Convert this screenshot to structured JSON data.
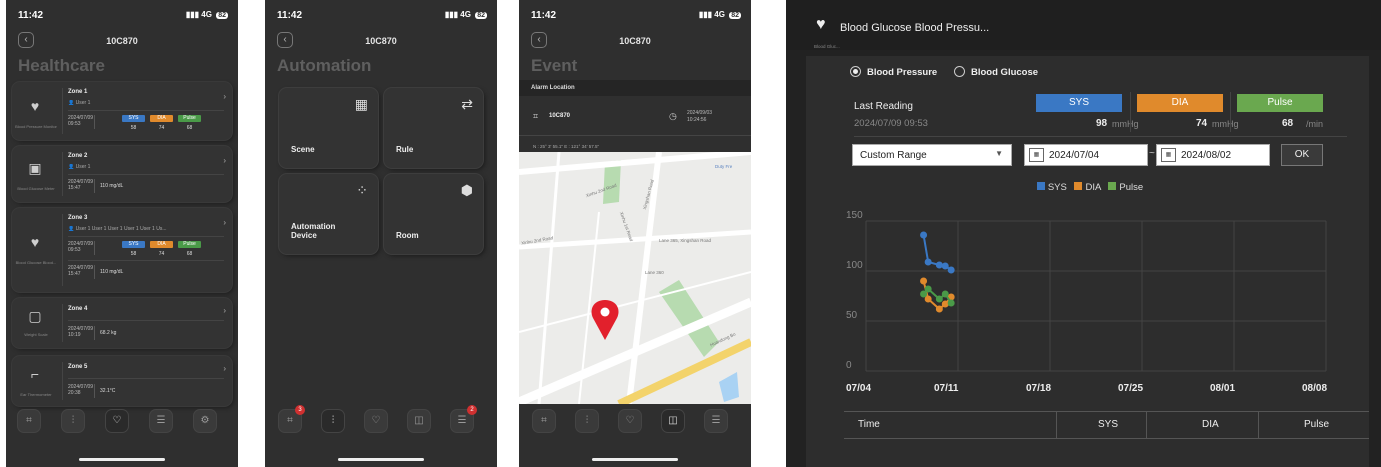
{
  "status": {
    "time": "11:42",
    "network": "4G",
    "battery": "82"
  },
  "device_id": "10C870",
  "healthcare": {
    "title": "Healthcare",
    "zones": [
      {
        "name": "Zone 1",
        "user": "User 1",
        "device": "Blood Pressure Monitor",
        "date": "2024/07/09",
        "time": "09:53",
        "sys": "58",
        "dia": "74",
        "pulse": "68",
        "bp_labels": [
          "SYS",
          "DIA",
          "Pulse"
        ]
      },
      {
        "name": "Zone 2",
        "user": "User 1",
        "device": "Blood Glucose Meter",
        "date": "2024/07/09",
        "time": "15:47",
        "value": "110 mg/dL"
      },
      {
        "name": "Zone 3",
        "user": "User 1 User 1 User 1 User 1 User 1 Us...",
        "device": "Blood Glucose Blood...",
        "date": "2024/07/09",
        "time": "09:53",
        "sys": "58",
        "dia": "74",
        "pulse": "68",
        "date2": "2024/07/09",
        "time2": "15:47",
        "value2": "110 mg/dL"
      },
      {
        "name": "Zone 4",
        "device": "Weight Scale",
        "date": "2024/07/09",
        "time": "10:19",
        "value": "68.2 kg"
      },
      {
        "name": "Zone 5",
        "device": "Ear Thermometer",
        "date": "2024/07/09",
        "time": "20:38",
        "value": "32.1°C"
      }
    ]
  },
  "automation": {
    "title": "Automation",
    "tiles": [
      {
        "label": "Scene"
      },
      {
        "label": "Rule"
      },
      {
        "label": "Automation Device"
      },
      {
        "label": "Room"
      }
    ],
    "badges": {
      "first": "3",
      "last": "2"
    }
  },
  "event": {
    "title": "Event",
    "alarm_location": "Alarm Location",
    "device": "10C870",
    "date": "2024/09/03",
    "time": "10:24:56",
    "coords": "N : 25° 3' 55.1\"   E : 121° 34' 57.5\"",
    "map_labels": [
      "Xinhu 2nd Road",
      "Xinhu 1st Road",
      "Xingshan Road",
      "Lane 365, Xingshan Road",
      "Duty Fre",
      "Xinhu 2nd Road",
      "Lane 360",
      "Huandong Bo"
    ]
  },
  "detail": {
    "title": "Blood Glucose Blood Pressu...",
    "subtitle": "Blood Gluc...",
    "radio_bp": "Blood Pressure",
    "radio_bg": "Blood Glucose",
    "last_reading_label": "Last Reading",
    "last_reading_date": "2024/07/09  09:53",
    "sys_label": "SYS",
    "dia_label": "DIA",
    "pulse_label": "Pulse",
    "sys_value": "98",
    "dia_value": "74",
    "pulse_value": "68",
    "mmhg": "mmHg",
    "per_min": "/min",
    "range_select": "Custom Range",
    "start_date": "2024/07/04",
    "end_date": "2024/08/02",
    "tilde": "~",
    "ok": "OK",
    "table_headers": [
      "Time",
      "SYS",
      "DIA",
      "Pulse"
    ]
  },
  "colors": {
    "sys": "#3a78c4",
    "dia": "#e08a2c",
    "pulse": "#4a9a48"
  },
  "chart_data": {
    "type": "line",
    "x_ticks": [
      "07/04",
      "07/11",
      "07/18",
      "07/25",
      "08/01",
      "08/08"
    ],
    "y_ticks": [
      "0",
      "50",
      "100",
      "150"
    ],
    "ylim": [
      0,
      150
    ],
    "legend": [
      "SYS",
      "DIA",
      "Pulse"
    ],
    "series": [
      {
        "name": "SYS",
        "color": "#3a78c4",
        "x": [
          "07/08",
          "07/08",
          "07/09",
          "07/09",
          "07/09"
        ],
        "values": [
          136,
          109,
          106,
          105,
          101
        ]
      },
      {
        "name": "DIA",
        "color": "#e08a2c",
        "x": [
          "07/08",
          "07/08",
          "07/09",
          "07/09",
          "07/09"
        ],
        "values": [
          90,
          72,
          62,
          67,
          74
        ]
      },
      {
        "name": "Pulse",
        "color": "#4a9a48",
        "x": [
          "07/08",
          "07/08",
          "07/09",
          "07/09",
          "07/09"
        ],
        "values": [
          77,
          82,
          72,
          77,
          68
        ]
      }
    ]
  }
}
